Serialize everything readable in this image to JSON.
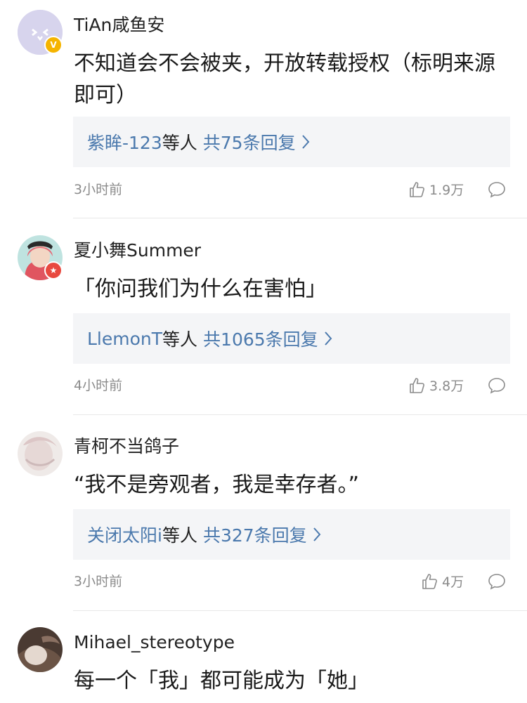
{
  "comments": [
    {
      "username": "TiAn咸鱼安",
      "text": "不知道会不会被夹，开放转载授权（标明来源即可）",
      "reply_user": "紫眸-123",
      "reply_mid": "等人",
      "reply_count": "共75条回复",
      "time": "3小时前",
      "likes": "1.9万",
      "badge": "V",
      "badge_color": "#f5b400"
    },
    {
      "username": "夏小舞Summer",
      "text": "「你问我们为什么在害怕」",
      "reply_user": "LlemonT",
      "reply_mid": "等人",
      "reply_count": "共1065条回复",
      "time": "4小时前",
      "likes": "3.8万",
      "badge": "★",
      "badge_color": "#e8493f"
    },
    {
      "username": "青柯不当鸽子",
      "text": "“我不是旁观者，我是幸存者。”",
      "reply_user": "关闭太阳i",
      "reply_mid": "等人",
      "reply_count": "共327条回复",
      "time": "3小时前",
      "likes": "4万"
    },
    {
      "username": "Mihael_stereotype",
      "text": "每一个「我」都可能成为「她」"
    }
  ]
}
